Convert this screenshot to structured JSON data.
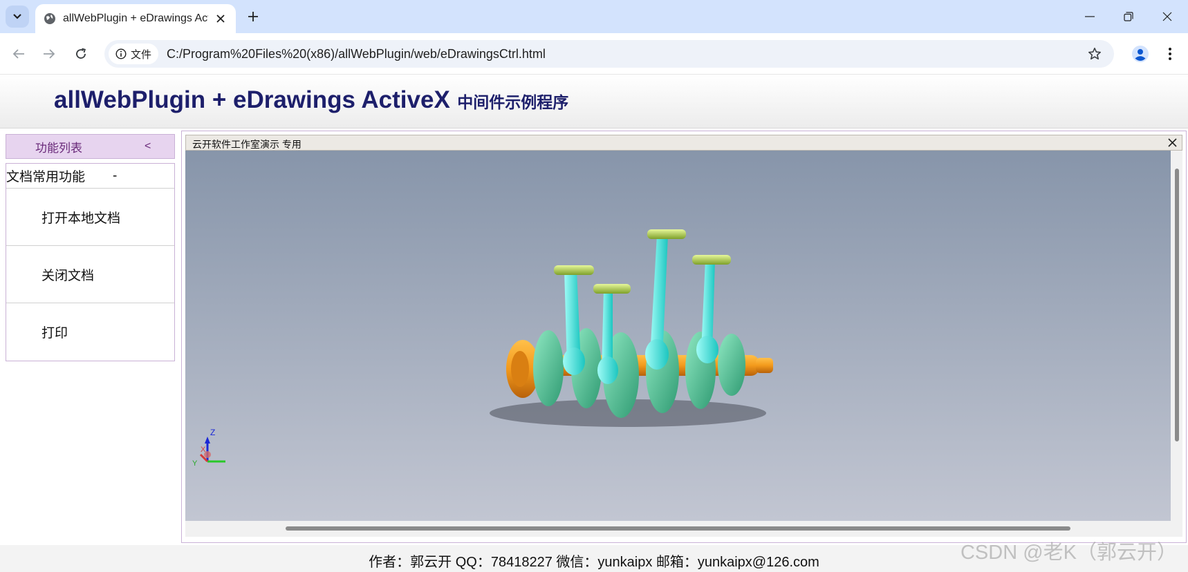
{
  "browser": {
    "tab_title": "allWebPlugin + eDrawings ActiveX",
    "security_chip": "文件",
    "url": "C:/Program%20Files%20(x86)/allWebPlugin/web/eDrawingsCtrl.html"
  },
  "header": {
    "title_en": "allWebPlugin + eDrawings ActiveX",
    "title_cn": "中间件示例程序"
  },
  "sidebar": {
    "heading": "功能列表",
    "collapse": "<",
    "group": {
      "title": "文档常用功能",
      "toggle": "-",
      "items": [
        {
          "label": "打开本地文档"
        },
        {
          "label": "关闭文档"
        },
        {
          "label": "打印"
        }
      ]
    }
  },
  "viewer": {
    "title": "云开软件工作室演示  专用",
    "triad_labels": {
      "z": "Z",
      "x": "X",
      "y": "Y"
    }
  },
  "footer": {
    "text": "作者：郭云开 QQ：78418227 微信：yunkaipx 邮箱：yunkaipx@126.com"
  },
  "watermark": "CSDN @老K（郭云开）",
  "colors": {
    "tabstrip": "#d3e3fd",
    "title": "#1d1f6b",
    "sidebar_head": "#e7d4ef",
    "rod": "#3fe6e0",
    "crank": "#4fc79a",
    "journal": "#f39a1c"
  }
}
